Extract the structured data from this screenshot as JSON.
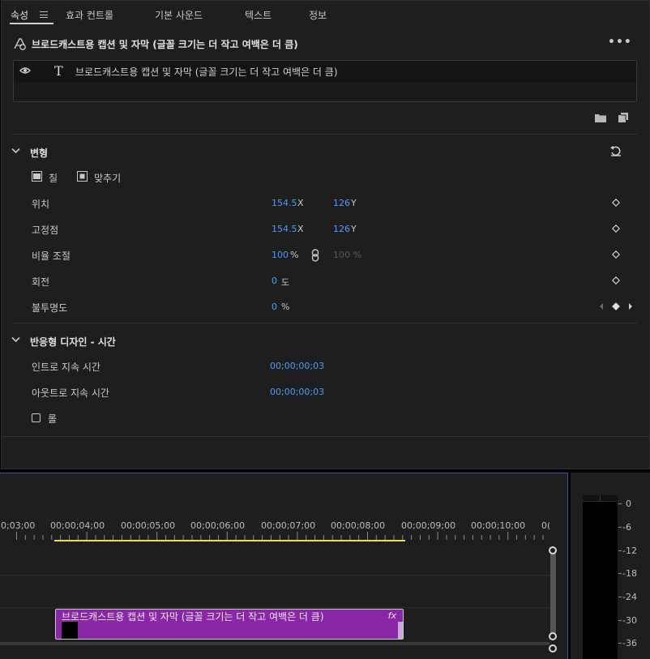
{
  "tabs": [
    {
      "label": "속성"
    },
    {
      "label": "효과 컨트롤"
    },
    {
      "label": "기본 사운드"
    },
    {
      "label": "텍스트"
    },
    {
      "label": "정보"
    }
  ],
  "header": {
    "title": "브로드캐스트용 캡션 및 자막  (글꼴 크기는 더 작고 여백은 더 큼)",
    "more": "•••"
  },
  "layer": {
    "type_glyph": "T",
    "label": "브로드캐스트용 캡션 및 자막  (글꼴 크기는 더 작고 여백은 더 큼)"
  },
  "transform": {
    "title": "변형",
    "fill_label": "칠",
    "fit_label": "맞추기",
    "position": {
      "label": "위치",
      "x": "154.5",
      "x_unit": "X",
      "y": "126",
      "y_unit": "Y"
    },
    "anchor": {
      "label": "고정점",
      "x": "154.5",
      "x_unit": "X",
      "y": "126",
      "y_unit": "Y"
    },
    "scale": {
      "label": "비율 조절",
      "value": "100",
      "unit": "%",
      "linked_value": "100 %"
    },
    "rotation": {
      "label": "회전",
      "value": "0",
      "unit": "도"
    },
    "opacity": {
      "label": "불투명도",
      "value": "0",
      "unit": "%"
    }
  },
  "responsive": {
    "title": "반응형 디자인 - 시간",
    "intro": {
      "label": "인트로 지속 시간",
      "value": "00;00;00;03"
    },
    "outro": {
      "label": "아웃트로 지속 시간",
      "value": "00;00;00;03"
    },
    "roll_label": "롤"
  },
  "timeline": {
    "timecodes": [
      "0;03;00",
      "00;00;04;00",
      "00;00;05;00",
      "00;00;06;00",
      "00;00;07;00",
      "00;00;08;00",
      "00;00;09;00",
      "00;00;10;00",
      "0("
    ],
    "clip": {
      "label": "브로드캐스트용 캡션 및 자막  (글꼴 크기는 더 작고 여백은 더 큼)",
      "fx": "fx",
      "color": "#8a26a8"
    },
    "work_area_color": "#e8e050"
  },
  "meter": {
    "db_labels": [
      "0",
      "-6",
      "-12",
      "-18",
      "-24",
      "-30",
      "-36"
    ]
  },
  "colors": {
    "accent_value": "#4a9eff",
    "panel_bg": "#1e1e1e",
    "focus_border": "#3a52a8"
  }
}
